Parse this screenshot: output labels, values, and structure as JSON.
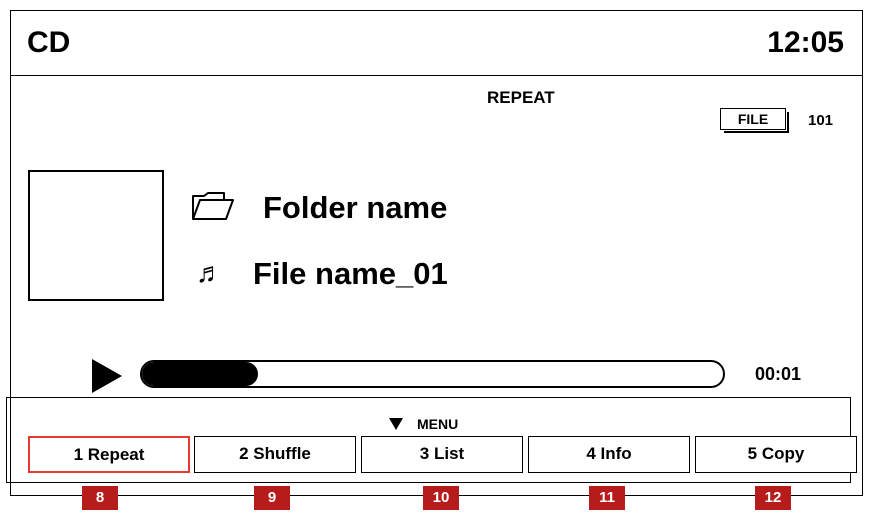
{
  "header": {
    "source": "CD",
    "clock": "12:05"
  },
  "status": {
    "repeat": "REPEAT",
    "file_badge": "FILE",
    "file_count": "101"
  },
  "now_playing": {
    "folder_name": "Folder name",
    "file_name": "File name_01"
  },
  "playback": {
    "elapsed": "00:01",
    "progress": 0.2
  },
  "icons": {
    "folder": "folder-open-icon",
    "note": "music-note-icon",
    "note_glyph": "♬",
    "play": "play-icon",
    "menu_arrow": "triangle-down-icon"
  },
  "menu": {
    "caption": "MENU",
    "items": [
      {
        "label": "1  Repeat",
        "callout": "8"
      },
      {
        "label": "2  Shuffle",
        "callout": "9"
      },
      {
        "label": "3  List",
        "callout": "10"
      },
      {
        "label": "4  Info",
        "callout": "11"
      },
      {
        "label": "5  Copy",
        "callout": "12"
      }
    ]
  },
  "colors": {
    "selected_border": "#e53935",
    "callout_bg": "#b71c1c"
  }
}
